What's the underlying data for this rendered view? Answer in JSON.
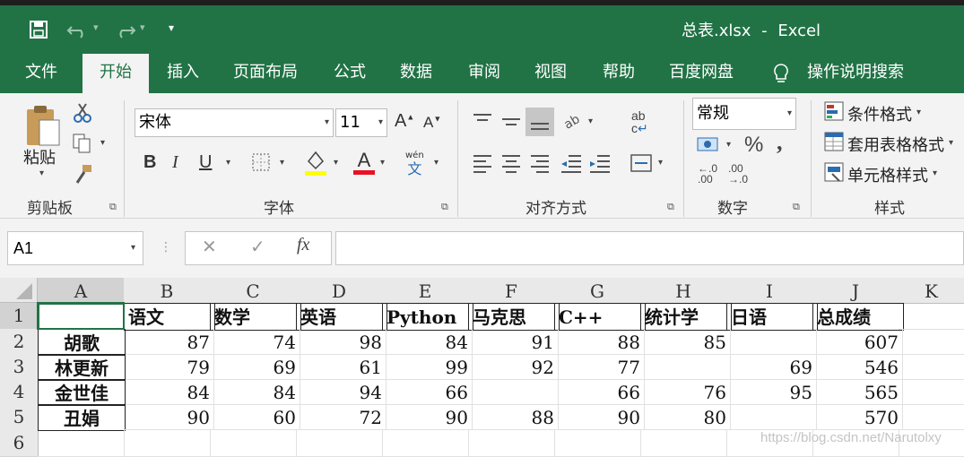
{
  "title_bar": {
    "filename": "总表.xlsx",
    "separator": "-",
    "app_name": "Excel",
    "qat_more": "▾"
  },
  "menu": {
    "tabs": [
      "文件",
      "开始",
      "插入",
      "页面布局",
      "公式",
      "数据",
      "审阅",
      "视图",
      "帮助",
      "百度网盘"
    ],
    "tell_me": "操作说明搜索",
    "active_index": 1
  },
  "ribbon": {
    "clipboard": {
      "paste_label": "粘贴",
      "group_label": "剪贴板"
    },
    "font": {
      "font_name": "宋体",
      "font_size": "11",
      "bold": "B",
      "italic": "I",
      "underline": "U",
      "font_color_letter": "A",
      "phonetic_top": "wén",
      "phonetic_bottom": "文",
      "grow": "A",
      "shrink": "A",
      "group_label": "字体"
    },
    "alignment": {
      "group_label": "对齐方式",
      "wrap_top": "ab",
      "wrap_bottom": "c"
    },
    "number": {
      "format": "常规",
      "percent": "%",
      "comma": ",",
      "inc_decimal_a": ".0",
      "inc_decimal_b": ".00",
      "dec_decimal_a": ".00",
      "dec_decimal_b": "→.0",
      "group_label": "数字"
    },
    "styles": {
      "conditional": "条件格式",
      "table": "套用表格格式",
      "cell": "单元格样式",
      "group_label": "样式"
    },
    "colors": {
      "accent": "#217346",
      "highlight": "#ffff00",
      "font_color": "#e81123"
    }
  },
  "formula_bar": {
    "name_box": "A1",
    "cancel": "✕",
    "enter": "✓",
    "fx": "fx",
    "content": ""
  },
  "sheet": {
    "columns": [
      "A",
      "B",
      "C",
      "D",
      "E",
      "F",
      "G",
      "H",
      "I",
      "J",
      "K"
    ],
    "rows": [
      "1",
      "2",
      "3",
      "4",
      "5",
      "6"
    ],
    "header_row": [
      "",
      "语文",
      "数学",
      "英语",
      "Python",
      "马克思",
      "C++",
      "统计学",
      "日语",
      "总成绩"
    ],
    "data": [
      {
        "name": "胡歌",
        "scores": [
          "87",
          "74",
          "98",
          "84",
          "91",
          "88",
          "85",
          "",
          "607"
        ]
      },
      {
        "name": "林更新",
        "scores": [
          "79",
          "69",
          "61",
          "99",
          "92",
          "77",
          "",
          "69",
          "546"
        ]
      },
      {
        "name": "金世佳",
        "scores": [
          "84",
          "84",
          "94",
          "66",
          "",
          "66",
          "76",
          "95",
          "565"
        ]
      },
      {
        "name": "丑娟",
        "scores": [
          "90",
          "60",
          "72",
          "90",
          "88",
          "90",
          "80",
          "",
          "570"
        ]
      }
    ],
    "watermark": "https://blog.csdn.net/Narutolxy"
  }
}
